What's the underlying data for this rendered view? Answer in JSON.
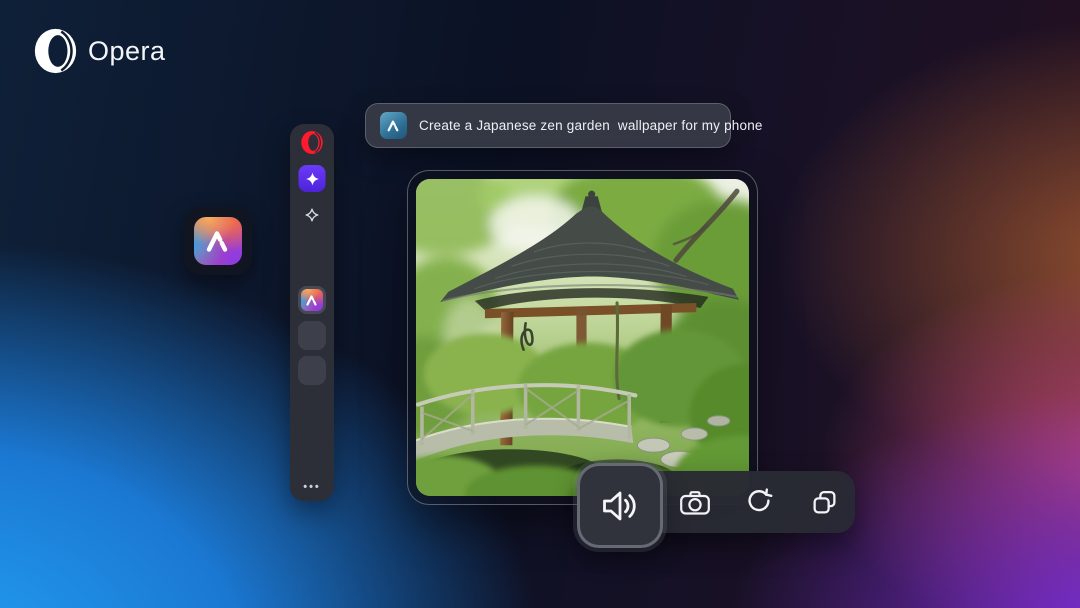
{
  "brand": {
    "name": "Opera"
  },
  "sidebar": {
    "more_label": "•••",
    "items": [
      {
        "id": "opera-menu",
        "icon": "opera-o-icon"
      },
      {
        "id": "aria-command-button",
        "icon": "sparkle-icon",
        "accent": "#5a2ee6"
      },
      {
        "id": "sparkle-shortcut",
        "icon": "sparkle-outline-icon"
      },
      {
        "id": "aria-app",
        "icon": "aria-icon",
        "active": true
      },
      {
        "id": "app-placeholder-1"
      },
      {
        "id": "app-placeholder-2"
      },
      {
        "id": "more-button",
        "label": "•••"
      }
    ]
  },
  "prompt": {
    "icon": "aria-thumbnail-icon",
    "text": "Create a Japanese zen garden  wallpaper for my phone"
  },
  "generated_image": {
    "description": "AI-generated Japanese zen garden: wooden gazebo with curved tiled roof, moss mounds, curved stone bridge with railing, stepping stones"
  },
  "toolbar": {
    "buttons": [
      {
        "id": "read-aloud",
        "icon": "speaker-icon",
        "highlighted": true
      },
      {
        "id": "capture",
        "icon": "camera-icon"
      },
      {
        "id": "regenerate",
        "icon": "refresh-icon"
      },
      {
        "id": "copy",
        "icon": "copy-icon"
      }
    ]
  },
  "colors": {
    "accent_purple": "#5a2ee6",
    "opera_red": "#ff1b2d",
    "panel_dark": "#2c2e38",
    "bg_blue": "#1e9bef",
    "bg_rust": "#96522f",
    "bg_magenta": "#c2447c",
    "bg_violet": "#7c2fe0"
  }
}
